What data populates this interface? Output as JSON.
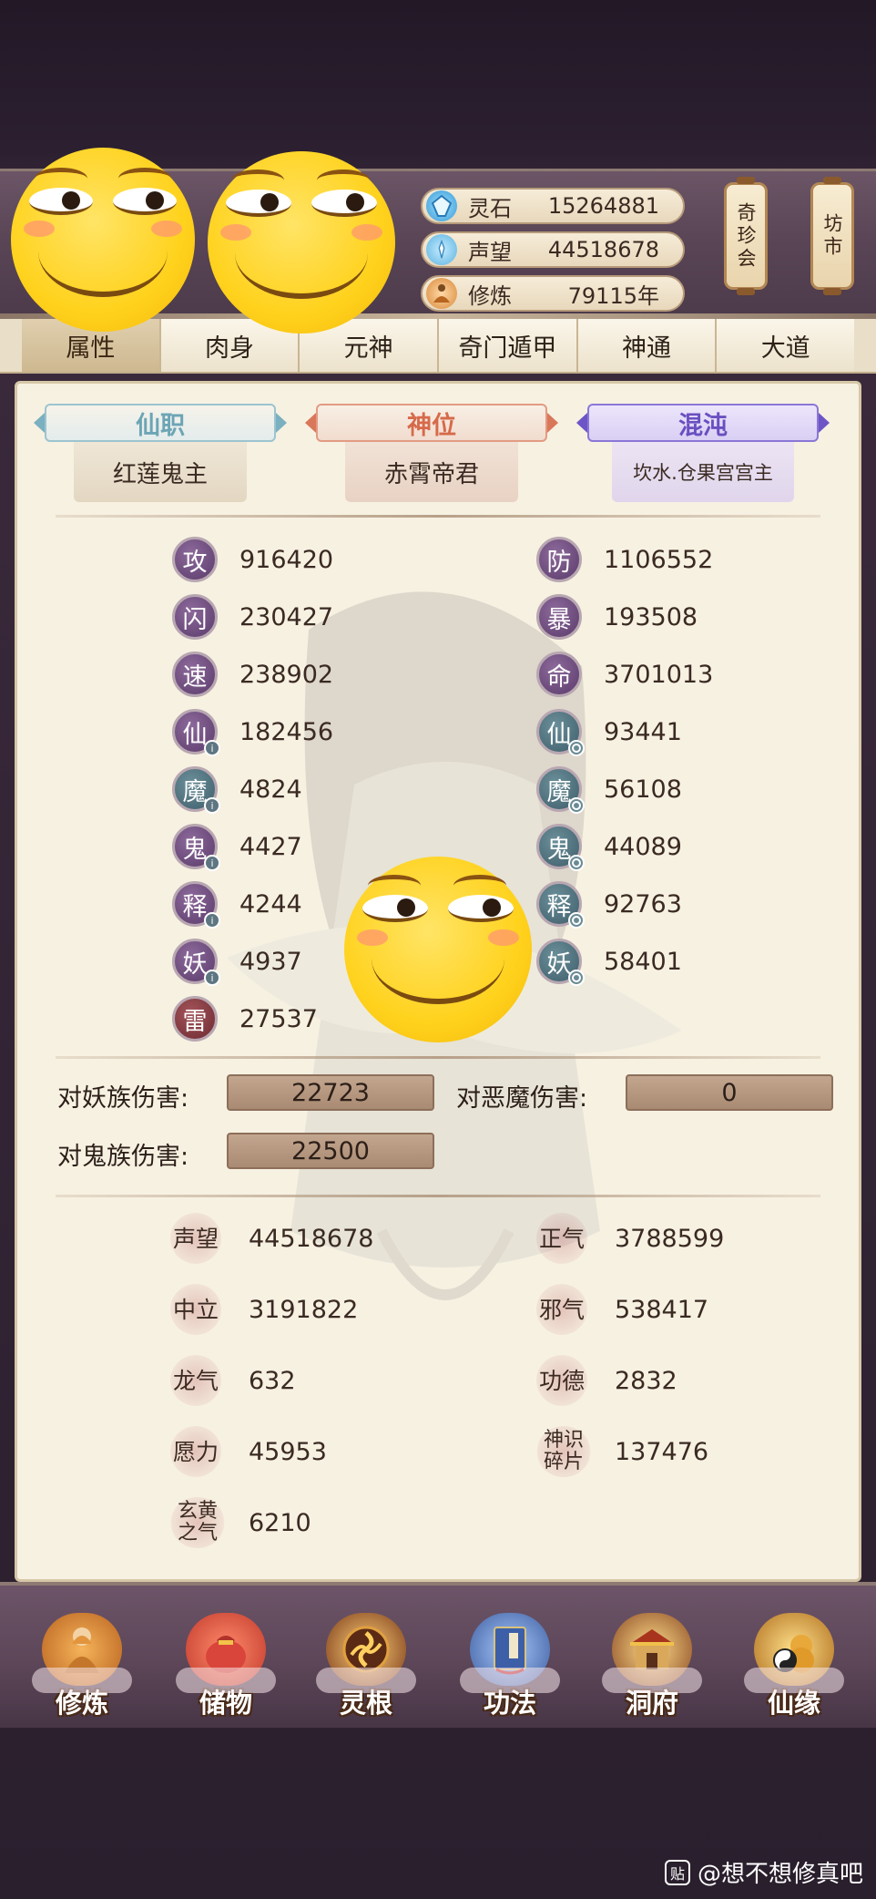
{
  "resources": [
    {
      "label": "灵石",
      "value": "15264881",
      "icon": "spirit-stone-icon"
    },
    {
      "label": "声望",
      "value": "44518678",
      "icon": "prestige-icon"
    },
    {
      "label": "修炼",
      "value": "79115年",
      "icon": "cultivation-icon"
    }
  ],
  "side_tags": [
    {
      "label": "奇珍会",
      "name": "treasure-market-button"
    },
    {
      "label": "坊市",
      "name": "market-button"
    }
  ],
  "tabs": [
    {
      "label": "属性",
      "active": true
    },
    {
      "label": "肉身",
      "active": false
    },
    {
      "label": "元神",
      "active": false
    },
    {
      "label": "奇门遁甲",
      "active": false
    },
    {
      "label": "神通",
      "active": false
    },
    {
      "label": "大道",
      "active": false
    }
  ],
  "titles": [
    {
      "header": "仙职",
      "value": "红莲鬼主",
      "color": "#6ca5b5"
    },
    {
      "header": "神位",
      "value": "赤霄帝君",
      "color": "#d66a4a"
    },
    {
      "header": "混沌",
      "value": "坎水.仓果宫宫主",
      "color": "#6a4fc0"
    }
  ],
  "stats_left": [
    {
      "label": "攻",
      "value": "916420",
      "style": "purple",
      "pip": ""
    },
    {
      "label": "闪",
      "value": "230427",
      "style": "purple",
      "pip": ""
    },
    {
      "label": "速",
      "value": "238902",
      "style": "purple",
      "pip": ""
    },
    {
      "label": "仙",
      "value": "182456",
      "style": "purple",
      "pip": "info"
    },
    {
      "label": "魔",
      "value": "4824",
      "style": "teal",
      "pip": "info"
    },
    {
      "label": "鬼",
      "value": "4427",
      "style": "purple",
      "pip": "info"
    },
    {
      "label": "释",
      "value": "4244",
      "style": "purple",
      "pip": "info"
    },
    {
      "label": "妖",
      "value": "4937",
      "style": "purple",
      "pip": "info"
    },
    {
      "label": "雷",
      "value": "27537",
      "style": "maroon",
      "pip": ""
    }
  ],
  "stats_right": [
    {
      "label": "防",
      "value": "1106552",
      "style": "purple",
      "pip": ""
    },
    {
      "label": "暴",
      "value": "193508",
      "style": "purple",
      "pip": ""
    },
    {
      "label": "命",
      "value": "3701013",
      "style": "purple",
      "pip": ""
    },
    {
      "label": "仙",
      "value": "93441",
      "style": "teal",
      "pip": "ring"
    },
    {
      "label": "魔",
      "value": "56108",
      "style": "teal",
      "pip": "ring"
    },
    {
      "label": "鬼",
      "value": "44089",
      "style": "teal",
      "pip": "ring"
    },
    {
      "label": "释",
      "value": "92763",
      "style": "teal",
      "pip": "ring"
    },
    {
      "label": "妖",
      "value": "58401",
      "style": "teal",
      "pip": "ring"
    }
  ],
  "damage": [
    {
      "label": "对妖族伤害:",
      "value": "22723"
    },
    {
      "label": "对恶魔伤害:",
      "value": "0"
    },
    {
      "label": "对鬼族伤害:",
      "value": "22500"
    }
  ],
  "reputation_left": [
    {
      "label": "声望",
      "value": "44518678"
    },
    {
      "label": "中立",
      "value": "3191822"
    },
    {
      "label": "龙气",
      "value": "632"
    },
    {
      "label": "愿力",
      "value": "45953"
    },
    {
      "label": "玄黄之气",
      "value": "6210"
    }
  ],
  "reputation_right": [
    {
      "label": "正气",
      "value": "3788599"
    },
    {
      "label": "邪气",
      "value": "538417"
    },
    {
      "label": "功德",
      "value": "2832"
    },
    {
      "label": "神识碎片",
      "value": "137476"
    }
  ],
  "bottom_nav": [
    {
      "label": "修炼",
      "icon": "meditating-monk-icon"
    },
    {
      "label": "储物",
      "icon": "storage-bag-icon"
    },
    {
      "label": "灵根",
      "icon": "spirit-root-icon"
    },
    {
      "label": "功法",
      "icon": "technique-book-icon"
    },
    {
      "label": "洞府",
      "icon": "cave-mansion-icon"
    },
    {
      "label": "仙缘",
      "icon": "immortal-fate-icon"
    }
  ],
  "watermark": "@想不想修真吧",
  "watermark_icon_text": "贴"
}
